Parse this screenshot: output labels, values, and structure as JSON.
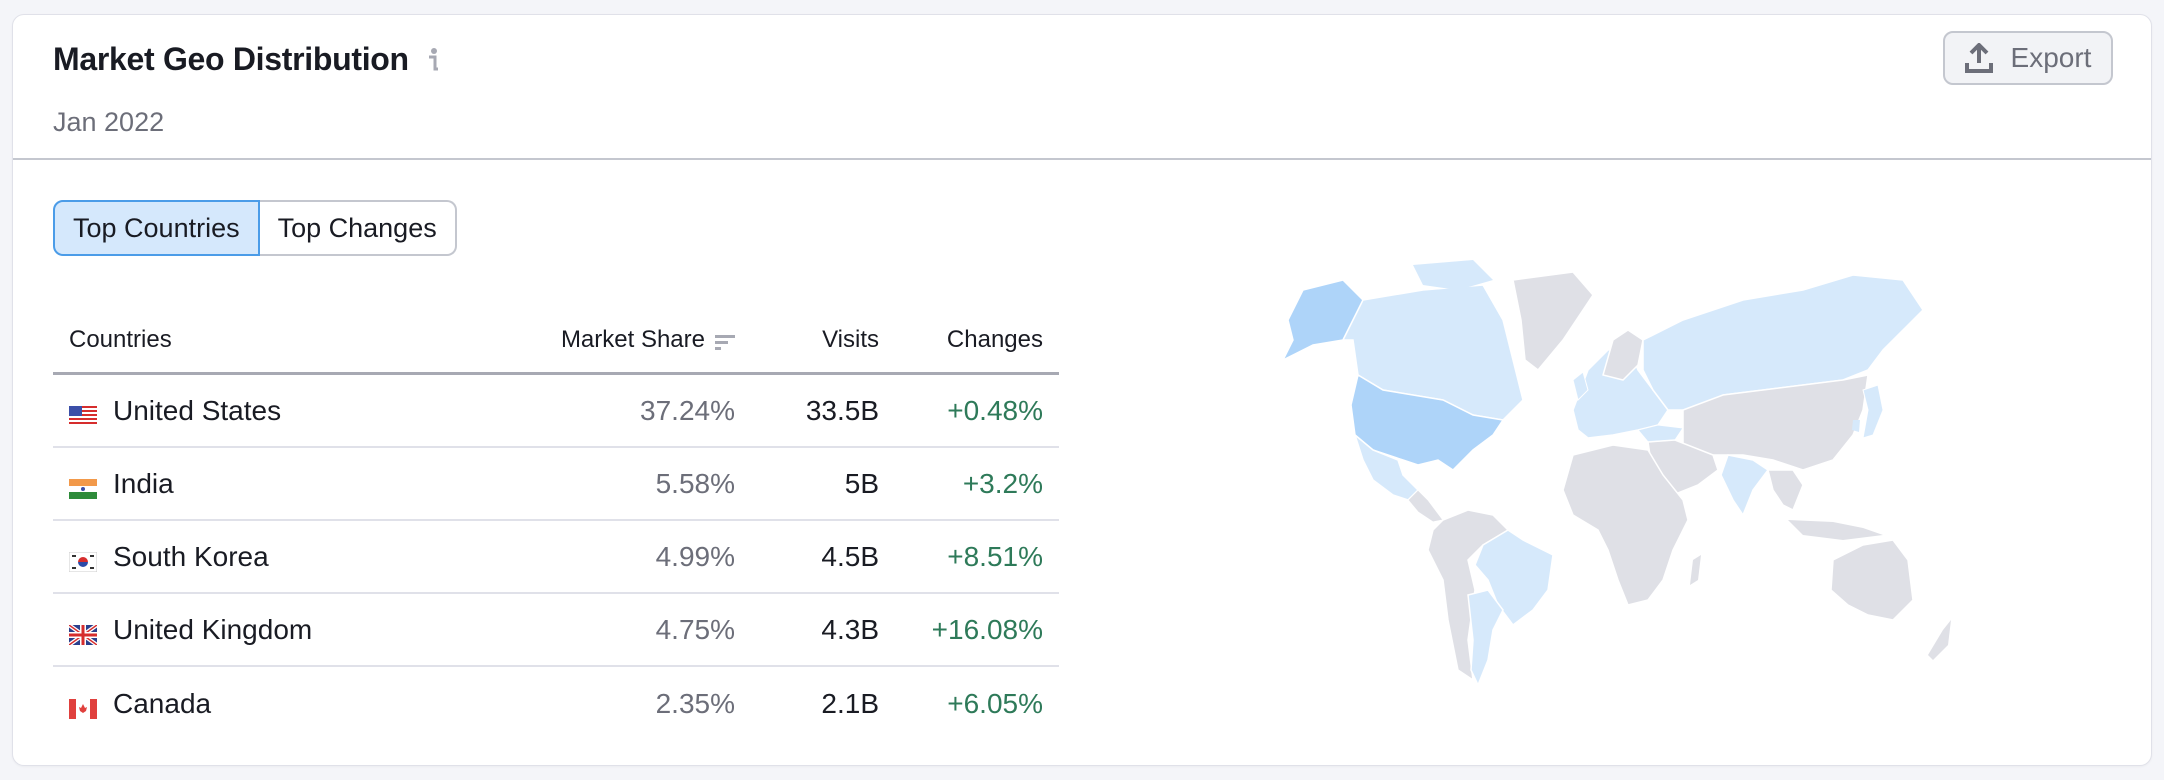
{
  "header": {
    "title": "Market Geo Distribution",
    "info_icon": "info-icon",
    "subtitle": "Jan 2022",
    "export_label": "Export",
    "export_icon": "upload-icon"
  },
  "tabs": [
    {
      "label": "Top Countries",
      "active": true
    },
    {
      "label": "Top Changes",
      "active": false
    }
  ],
  "table": {
    "columns": {
      "country": "Countries",
      "share": "Market Share",
      "visits": "Visits",
      "changes": "Changes"
    },
    "sort_icon": "sort-descending-icon",
    "rows": [
      {
        "flag": "us-flag-icon",
        "country": "United States",
        "share": "37.24%",
        "visits": "33.5B",
        "change": "+0.48%"
      },
      {
        "flag": "in-flag-icon",
        "country": "India",
        "share": "5.58%",
        "visits": "5B",
        "change": "+3.2%"
      },
      {
        "flag": "kr-flag-icon",
        "country": "South Korea",
        "share": "4.99%",
        "visits": "4.5B",
        "change": "+8.51%"
      },
      {
        "flag": "gb-flag-icon",
        "country": "United Kingdom",
        "share": "4.75%",
        "visits": "4.3B",
        "change": "+16.08%"
      },
      {
        "flag": "ca-flag-icon",
        "country": "Canada",
        "share": "2.35%",
        "visits": "2.1B",
        "change": "+6.05%"
      }
    ]
  },
  "colors": {
    "map_highlight_strong": "#aed4f9",
    "map_highlight_light": "#d6e9fb",
    "map_neutral": "#dfe0e6",
    "change_positive": "#2e7a59",
    "tab_active_bg": "#d5e8fc",
    "tab_active_border": "#4b9ce8"
  },
  "map": {
    "strong_regions": [
      "United States"
    ],
    "light_regions": [
      "Canada",
      "Mexico",
      "Brazil",
      "Argentina",
      "Europe",
      "Russia",
      "Turkey",
      "India",
      "Japan",
      "South Korea"
    ]
  }
}
